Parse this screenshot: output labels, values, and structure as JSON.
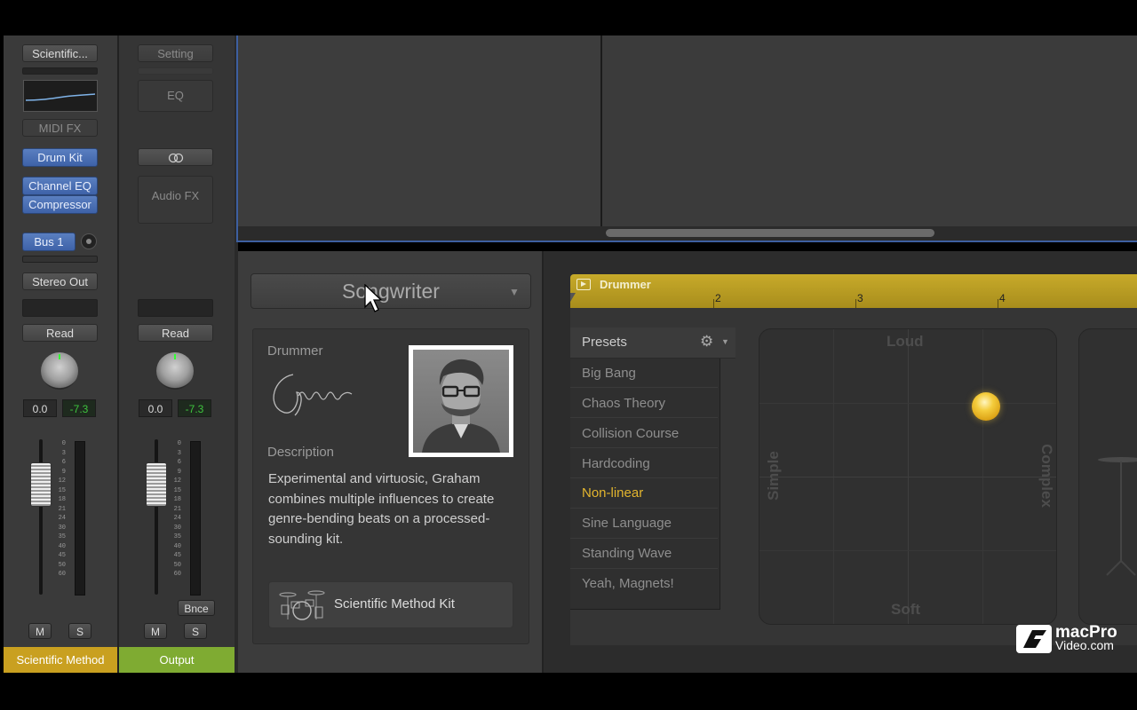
{
  "strip1": {
    "setting": "Scientific...",
    "midi_fx": "MIDI FX",
    "instrument": "Drum Kit",
    "audio_fx": [
      "Channel EQ",
      "Compressor"
    ],
    "send": "Bus 1",
    "output": "Stereo Out",
    "automation": "Read",
    "pan_value": "0.0",
    "level_value": "-7.3",
    "mute": "M",
    "solo": "S",
    "name": "Scientific Method",
    "name_color": "#c9a020"
  },
  "strip2": {
    "setting": "Setting",
    "eq": "EQ",
    "audio_fx": "Audio FX",
    "automation": "Read",
    "pan_value": "0.0",
    "level_value": "-7.3",
    "bounce": "Bnce",
    "mute": "M",
    "solo": "S",
    "name": "Output",
    "name_color": "#7fab32"
  },
  "fader_scale": [
    "0",
    "3",
    "6",
    "9",
    "12",
    "15",
    "18",
    "21",
    "24",
    "30",
    "35",
    "40",
    "45",
    "50",
    "60"
  ],
  "songwriter": {
    "genre": "Songwriter",
    "drummer_label": "Drummer",
    "drummer_signature": "Graham",
    "description_label": "Description",
    "description": "Experimental and virtuosic, Graham combines multiple influences to create genre-bending beats on a processed-sounding kit.",
    "kit_name": "Scientific Method Kit"
  },
  "editor": {
    "region_title": "Drummer",
    "ruler": [
      "2",
      "3",
      "4"
    ],
    "presets_title": "Presets",
    "presets": [
      {
        "label": "Big Bang",
        "active": false
      },
      {
        "label": "Chaos Theory",
        "active": false
      },
      {
        "label": "Collision Course",
        "active": false
      },
      {
        "label": "Hardcoding",
        "active": false
      },
      {
        "label": "Non-linear",
        "active": true
      },
      {
        "label": "Sine Language",
        "active": false
      },
      {
        "label": "Standing Wave",
        "active": false
      },
      {
        "label": "Yeah, Magnets!",
        "active": false
      }
    ],
    "xy_labels": {
      "top": "Loud",
      "bottom": "Soft",
      "left": "Simple",
      "right": "Complex"
    },
    "accent_color": "#e3b52e"
  },
  "watermark": {
    "brand": "macPro",
    "sub": "Video.com"
  }
}
